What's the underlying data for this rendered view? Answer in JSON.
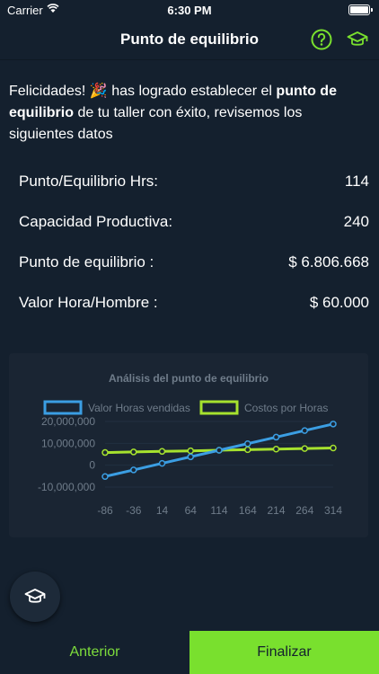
{
  "status_bar": {
    "carrier": "Carrier",
    "time": "6:30 PM"
  },
  "header": {
    "title": "Punto de equilibrio",
    "help_icon": "help-circle-icon",
    "info_icon": "graduation-cap-icon"
  },
  "intro": {
    "lead": "Felicidades! ",
    "emoji": "🎉",
    "mid": " has logrado establecer el ",
    "bold": "punto de equilibrio",
    "tail": " de tu taller con éxito, revisemos los siguientes datos"
  },
  "stats": [
    {
      "label": "Punto/Equilibrio Hrs:",
      "value": "114"
    },
    {
      "label": "Capacidad Productiva:",
      "value": "240"
    },
    {
      "label": "Punto de equilibrio :",
      "value": "$ 6.806.668"
    },
    {
      "label": "Valor Hora/Hombre :",
      "value": "$ 60.000"
    }
  ],
  "colors": {
    "accent": "#79e02e",
    "series_blue": "#3b9ee3",
    "series_green": "#a6e22e",
    "background": "#14202e"
  },
  "chart_data": {
    "type": "line",
    "title": "Análisis del punto de equilibrio",
    "x": [
      -86,
      -36,
      14,
      64,
      114,
      164,
      214,
      264,
      314
    ],
    "x_tick_labels": [
      "-86",
      "-36",
      "14",
      "64",
      "114",
      "164",
      "214",
      "264",
      "314"
    ],
    "y_tick_labels": [
      "20,000,000",
      "10,000,000",
      "0",
      "-10,000,000"
    ],
    "y_ticks": [
      20000000,
      10000000,
      0,
      -10000000
    ],
    "ylim": [
      -10000000,
      20000000
    ],
    "series": [
      {
        "name": "Valor Horas vendidas",
        "color": "#3b9ee3",
        "values": [
          -5160000,
          -2160000,
          840000,
          3840000,
          6840000,
          9840000,
          12840000,
          15840000,
          18840000
        ]
      },
      {
        "name": "Costos por Horas",
        "color": "#a6e22e",
        "values": [
          5800000,
          6060000,
          6320000,
          6580000,
          6840000,
          7100000,
          7360000,
          7620000,
          7880000
        ]
      }
    ],
    "legend": "top"
  },
  "fab": {
    "icon": "graduation-cap-icon"
  },
  "footer": {
    "prev_label": "Anterior",
    "finish_label": "Finalizar"
  }
}
